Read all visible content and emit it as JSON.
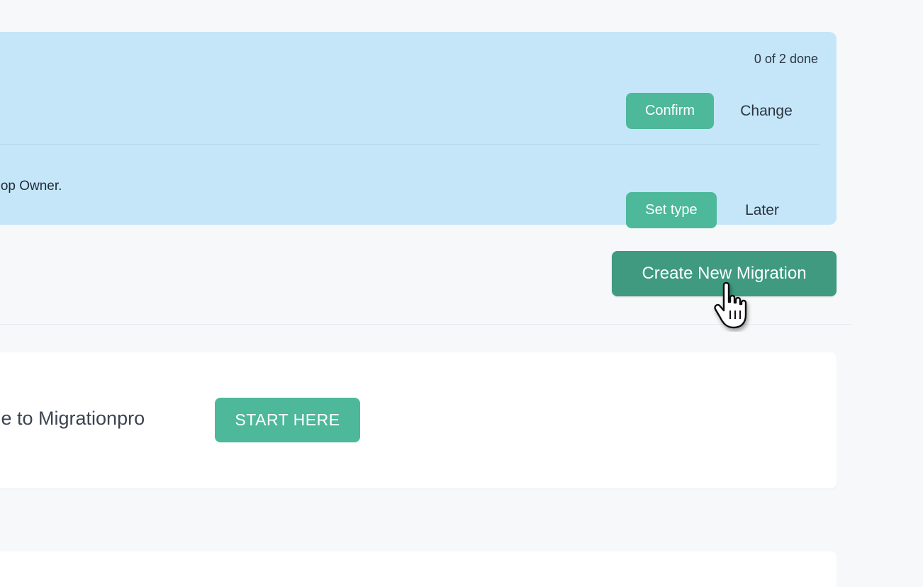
{
  "onboarding": {
    "progress": "0 of 2 done",
    "tasks": [
      {
        "description": "",
        "primary_label": "Confirm",
        "secondary_label": "Change"
      },
      {
        "description": "ency or Shop Owner.",
        "primary_label": "Set type",
        "secondary_label": "Later"
      }
    ]
  },
  "actions": {
    "create_label": "Create New Migration"
  },
  "welcome": {
    "text": "me to Migrationpro",
    "start_label": "START HERE"
  },
  "icons": {
    "cursor": "hand-pointer-icon"
  },
  "colors": {
    "banner_bg": "#c5e6f8",
    "accent": "#4db89a",
    "accent_dark": "#3f9a7f",
    "page_bg": "#f7f8fa"
  }
}
